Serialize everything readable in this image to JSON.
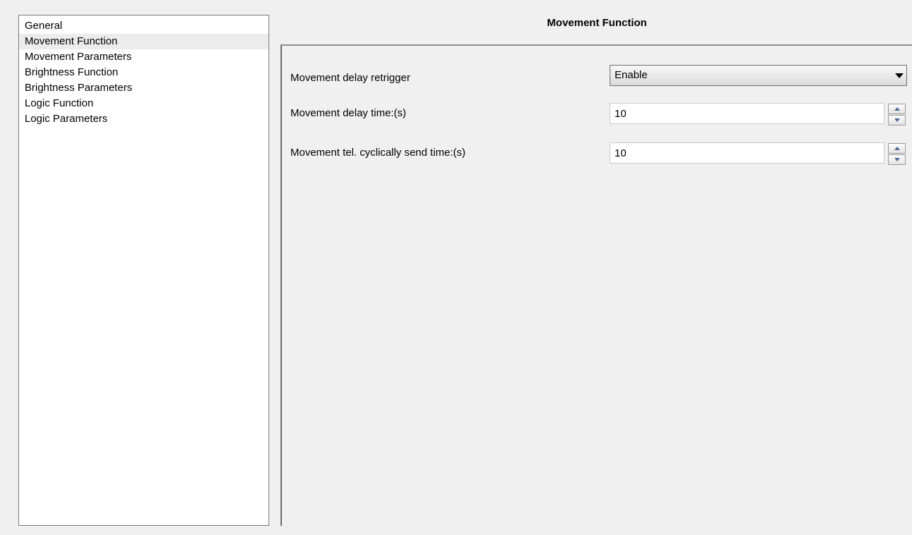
{
  "sidebar": {
    "items": [
      {
        "label": "General"
      },
      {
        "label": "Movement Function"
      },
      {
        "label": "Movement Parameters"
      },
      {
        "label": "Brightness Function"
      },
      {
        "label": "Brightness Parameters"
      },
      {
        "label": "Logic Function"
      },
      {
        "label": "Logic Parameters"
      }
    ],
    "selected": "Movement Function"
  },
  "page": {
    "title": "Movement Function"
  },
  "params": {
    "retrigger": {
      "label": "Movement delay retrigger",
      "value": "Enable"
    },
    "delay_time": {
      "label": "Movement delay time:(s)",
      "value": "10"
    },
    "cyclic_time": {
      "label": "Movement tel. cyclically send time:(s)",
      "value": "10"
    }
  },
  "icons": {
    "dropdown": "chevron-down-icon",
    "spin_up": "arrow-up-icon",
    "spin_down": "arrow-down-icon"
  },
  "colors": {
    "window_bg": "#f0f0f0",
    "list_bg": "#ffffff",
    "selected_item_bg": "#ececec",
    "spinner_arrow": "#4a6a9a"
  }
}
